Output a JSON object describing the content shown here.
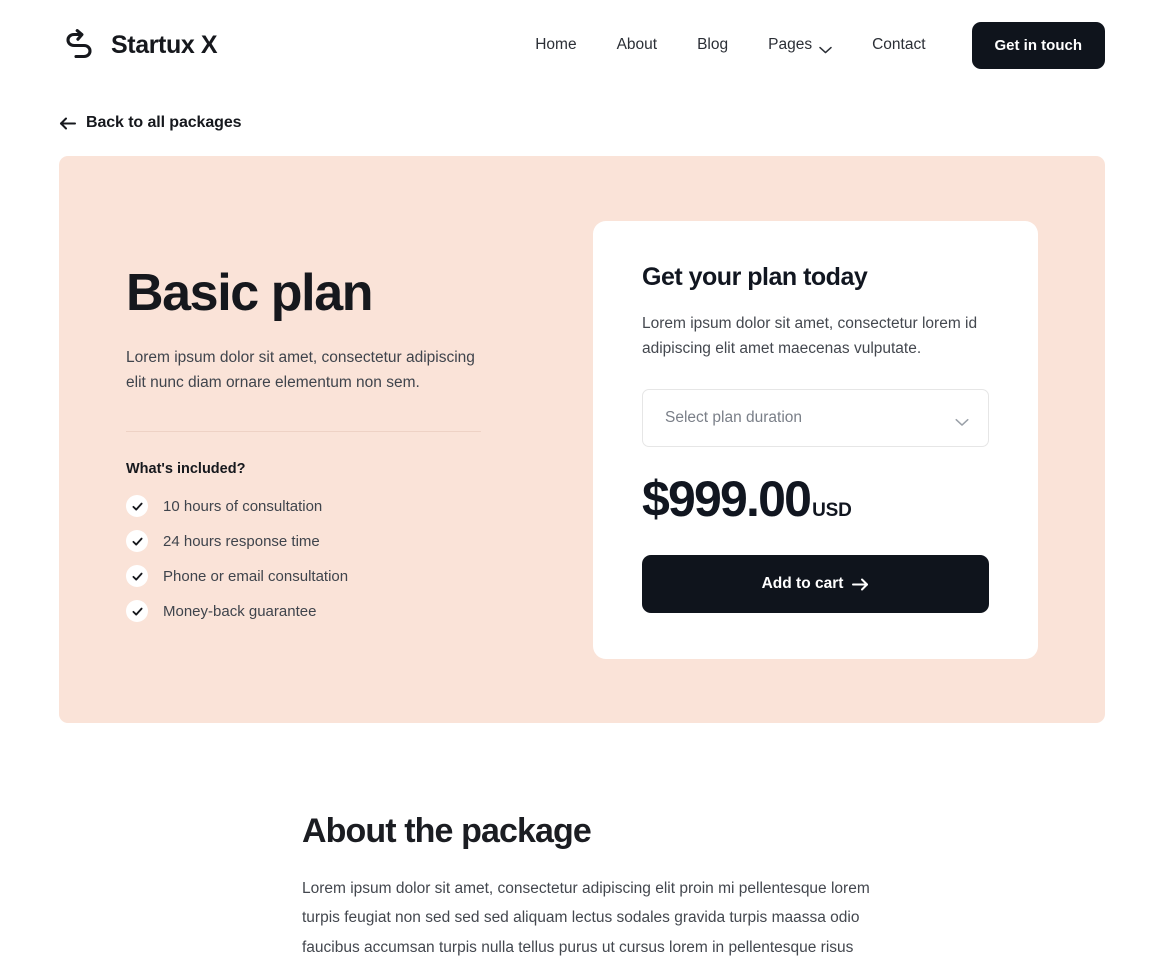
{
  "header": {
    "brand_name": "Startux X",
    "logo_icon": "swoosh-arrow-logo",
    "nav": [
      {
        "label": "Home",
        "icon": null
      },
      {
        "label": "About",
        "icon": null
      },
      {
        "label": "Blog",
        "icon": null
      },
      {
        "label": "Pages",
        "icon": "chevron-down-icon"
      },
      {
        "label": "Contact",
        "icon": null
      }
    ],
    "cta_label": "Get in touch"
  },
  "back": {
    "label": "Back to all packages",
    "icon": "arrow-left-icon"
  },
  "hero": {
    "background_color": "#fae3d8",
    "plan_title": "Basic plan",
    "plan_description": "Lorem ipsum dolor sit amet, consectetur adipiscing elit nunc diam ornare elementum non sem.",
    "included_title": "What's included?",
    "features": [
      "10 hours of consultation",
      "24 hours response time",
      "Phone or email consultation",
      "Money-back guarantee"
    ]
  },
  "plan_card": {
    "title": "Get your plan today",
    "description": "Lorem ipsum dolor sit amet, consectetur lorem id adipiscing elit amet maecenas vulputate.",
    "select": {
      "placeholder": "Select plan duration",
      "value": "",
      "icon": "chevron-down-icon",
      "options": [
        "Select plan duration"
      ]
    },
    "price": "$999.00",
    "currency": "USD",
    "cart_button_label": "Add to cart",
    "cart_button_icon": "arrow-right-icon",
    "button_color": "#0f141c"
  },
  "about": {
    "title": "About the package",
    "body": "Lorem ipsum dolor sit amet, consectetur adipiscing elit proin mi pellentesque  lorem turpis feugiat non sed sed sed aliquam lectus sodales gravida turpis maassa odio faucibus accumsan turpis nulla tellus purus ut   cursus lorem  in pellentesque risus"
  }
}
